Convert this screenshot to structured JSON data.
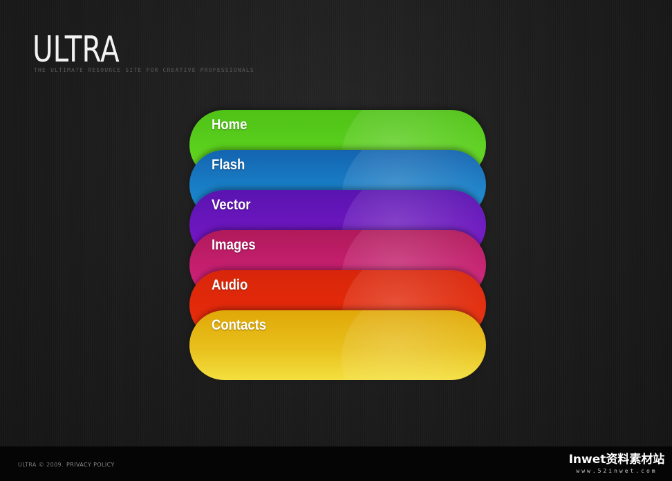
{
  "header": {
    "logo": "ULTRA",
    "tagline": "THE ULTIMATE RESOURCE SITE FOR CREATIVE PROFESSIONALS"
  },
  "menu": {
    "items": [
      {
        "label": "Home",
        "color": "#5cd11e"
      },
      {
        "label": "Flash",
        "color": "#1a86cc"
      },
      {
        "label": "Vector",
        "color": "#6e16c0"
      },
      {
        "label": "Images",
        "color": "#c81f72"
      },
      {
        "label": "Audio",
        "color": "#e42a0a"
      },
      {
        "label": "Contacts",
        "color": "#e8c01c"
      }
    ]
  },
  "footer": {
    "copyright": "ULTRA © 2009.",
    "privacy": "PRIVACY POLICY"
  },
  "watermark": {
    "main": "Inwet资料素材站",
    "url": "www.52inwet.com"
  }
}
